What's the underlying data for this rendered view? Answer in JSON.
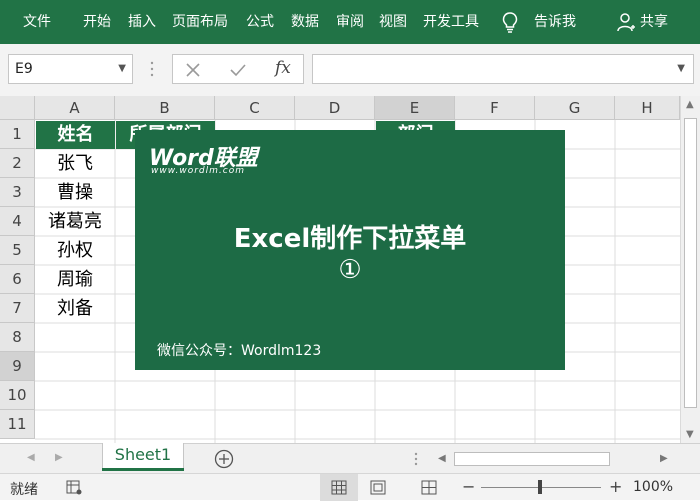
{
  "ribbon": {
    "tabs": [
      "文件",
      "开始",
      "插入",
      "页面布局",
      "公式",
      "数据",
      "审阅",
      "视图",
      "开发工具"
    ],
    "tell_me": "告诉我",
    "share": "共享",
    "bg_color": "#217346"
  },
  "formula_bar": {
    "name_box": "E9",
    "fx_label": "fx",
    "cancel_icon": "x-icon",
    "enter_icon": "check-icon",
    "formula_value": ""
  },
  "grid": {
    "columns": [
      "A",
      "B",
      "C",
      "D",
      "E",
      "F",
      "G",
      "H"
    ],
    "rows": [
      "1",
      "2",
      "3",
      "4",
      "5",
      "6",
      "7",
      "8",
      "9",
      "10",
      "11"
    ],
    "header_cells": {
      "A1": "姓名",
      "B1": "所属部门",
      "E1": "部门"
    },
    "names": [
      "张飞",
      "曹操",
      "诸葛亮",
      "孙权",
      "周瑜",
      "刘备"
    ],
    "header_fill": "#217346"
  },
  "banner": {
    "logo": "Word联盟",
    "logo_url": "www.wordlm.com",
    "title": "Excel制作下拉菜单",
    "number": "①",
    "footer": "微信公众号：Wordlm123",
    "bg_color": "#1d6b45"
  },
  "sheets": {
    "active": "Sheet1"
  },
  "status": {
    "text": "就绪",
    "zoom": "100%"
  }
}
